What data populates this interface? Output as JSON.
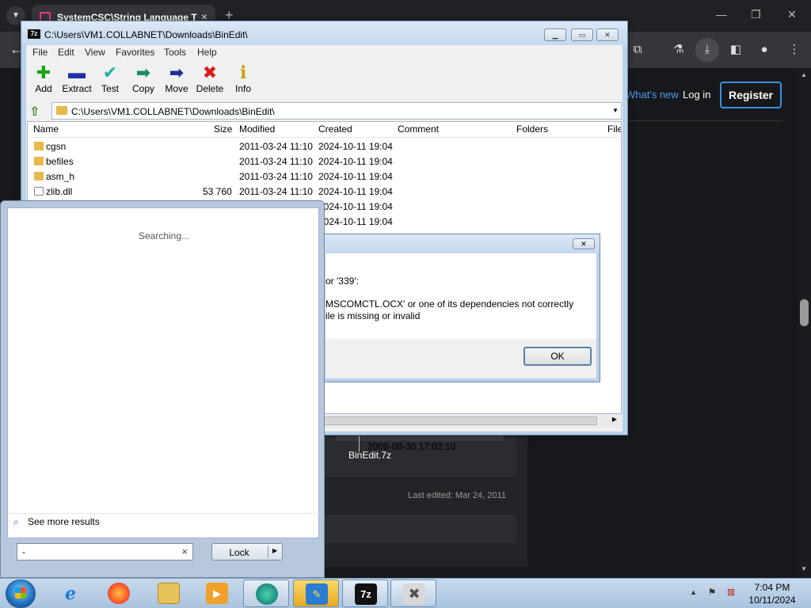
{
  "browser": {
    "tab_title": "SystemCSC\\String Language T",
    "tab_close": "×",
    "new_tab": "+",
    "whats_new": "What's new",
    "log_in": "Log in",
    "register": "Register",
    "attachment_name": "BinEdit.7z",
    "last_edited": "Last edited: Mar 24, 2011"
  },
  "zip": {
    "logo": "7z",
    "title": "C:\\Users\\VM1.COLLABNET\\Downloads\\BinEdit\\",
    "menu": [
      "File",
      "Edit",
      "View",
      "Favorites",
      "Tools",
      "Help"
    ],
    "toolbar": [
      {
        "label": "Add",
        "glyph": "✚",
        "color": "#19a319"
      },
      {
        "label": "Extract",
        "glyph": "▬",
        "color": "#1d2fa8"
      },
      {
        "label": "Test",
        "glyph": "✔",
        "color": "#1fb0b0"
      },
      {
        "label": "Copy",
        "glyph": "➡",
        "color": "#1d8a6a"
      },
      {
        "label": "Move",
        "glyph": "➡",
        "color": "#1d2f9a"
      },
      {
        "label": "Delete",
        "glyph": "✖",
        "color": "#d81e1e"
      },
      {
        "label": "Info",
        "glyph": "ℹ",
        "color": "#c8a000"
      }
    ],
    "address": "C:\\Users\\VM1.COLLABNET\\Downloads\\BinEdit\\",
    "columns": {
      "name": "Name",
      "size": "Size",
      "modified": "Modified",
      "created": "Created",
      "comment": "Comment",
      "folders": "Folders",
      "files": "File"
    },
    "rows": [
      {
        "name": "cgsn",
        "size": "",
        "modified": "2011-03-24 11:10",
        "created": "2024-10-11 19:04",
        "type": "folder"
      },
      {
        "name": "befiles",
        "size": "",
        "modified": "2011-03-24 11:10",
        "created": "2024-10-11 19:04",
        "type": "folder"
      },
      {
        "name": "asm_h",
        "size": "",
        "modified": "2011-03-24 11:10",
        "created": "2024-10-11 19:04",
        "type": "folder"
      },
      {
        "name": "zlib.dll",
        "size": "53 760",
        "modified": "2011-03-24 11:10",
        "created": "2024-10-11 19:04",
        "type": "dll"
      },
      {
        "name": "",
        "size": "",
        "modified": "",
        "created": "2024-10-11 19:04",
        "type": "hidden"
      },
      {
        "name": "",
        "size": "",
        "modified": "",
        "created": "2024-10-11 19:04",
        "type": "hidden"
      }
    ],
    "status_date": "2009-08-30 17:02:10"
  },
  "dialog": {
    "line1": "or '339':",
    "line2": "MSCOMCTL.OCX' or one of its dependencies not correctly",
    "line3": "ile is missing or invalid",
    "ok": "OK"
  },
  "start_menu": {
    "searching": "Searching...",
    "see_more": "See more results",
    "search_value": "-",
    "lock": "Lock"
  },
  "taskbar": {
    "time": "7:04 PM",
    "date": "10/11/2024",
    "zip_label": "7z"
  }
}
